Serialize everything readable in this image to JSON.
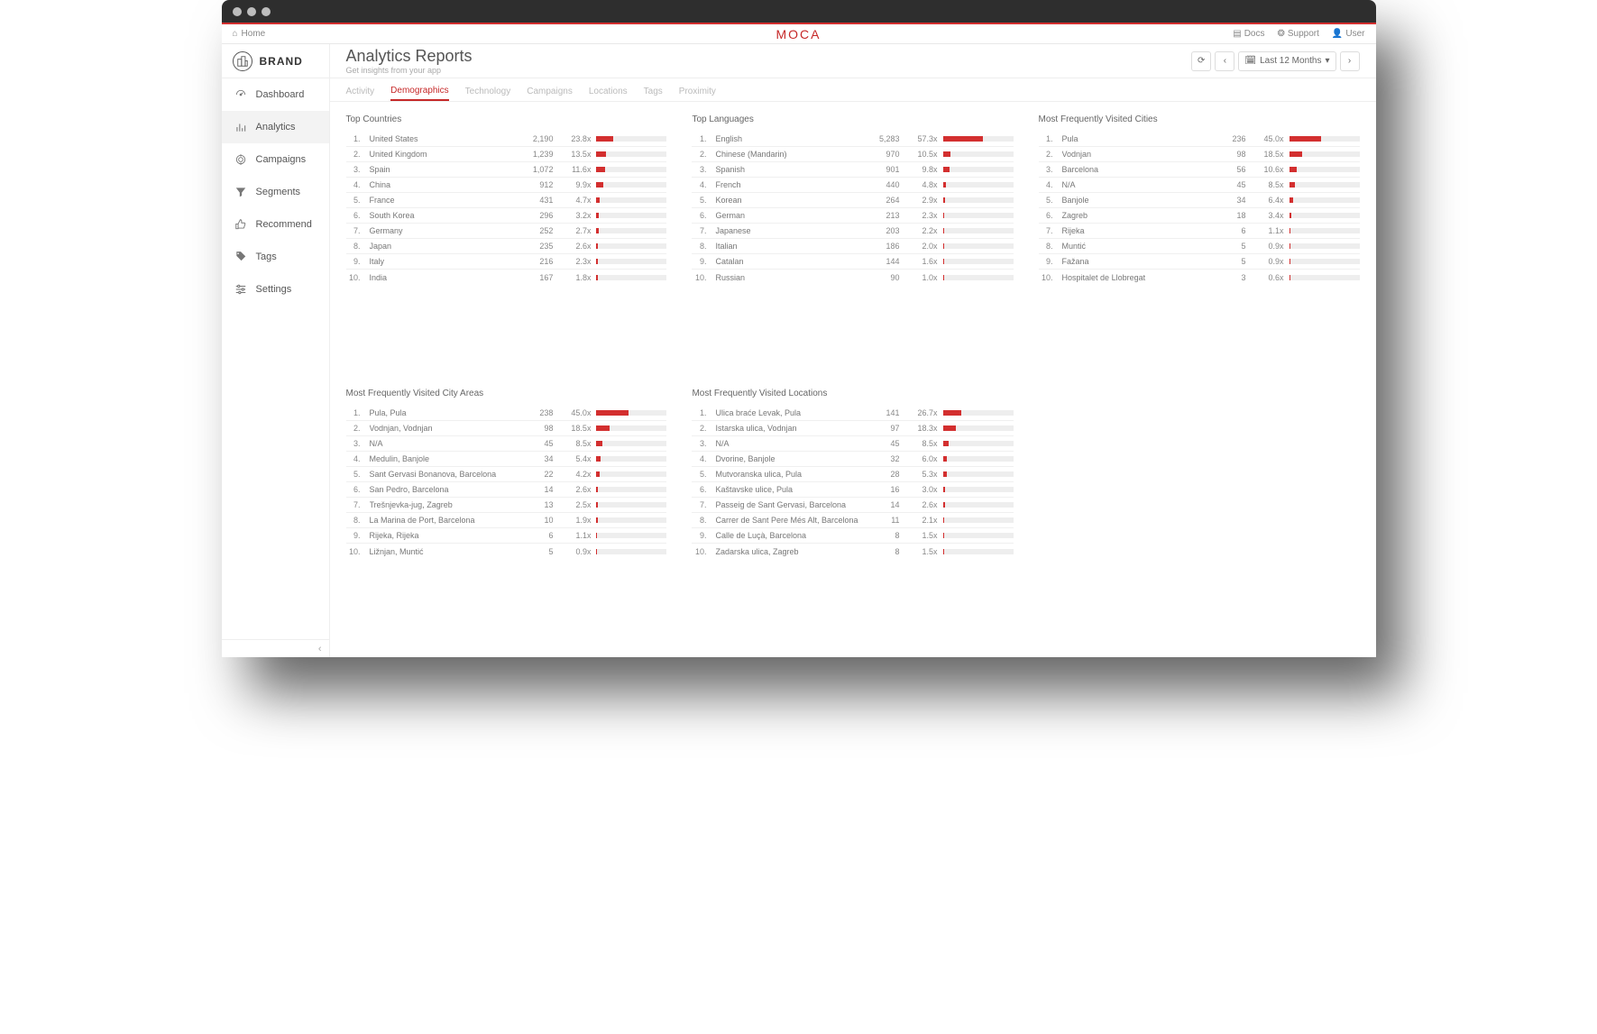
{
  "topbar": {
    "home": "Home",
    "logo": "MOCA",
    "docs": "Docs",
    "support": "Support",
    "user": "User"
  },
  "brand": {
    "name": "BRAND"
  },
  "sidebar": {
    "items": [
      {
        "id": "dashboard",
        "label": "Dashboard",
        "icon": "gauge"
      },
      {
        "id": "analytics",
        "label": "Analytics",
        "icon": "bars",
        "active": true
      },
      {
        "id": "campaigns",
        "label": "Campaigns",
        "icon": "target"
      },
      {
        "id": "segments",
        "label": "Segments",
        "icon": "filter"
      },
      {
        "id": "recommend",
        "label": "Recommend",
        "icon": "thumbs-up"
      },
      {
        "id": "tags",
        "label": "Tags",
        "icon": "tag"
      },
      {
        "id": "settings",
        "label": "Settings",
        "icon": "sliders"
      }
    ]
  },
  "header": {
    "title": "Analytics Reports",
    "subtitle": "Get insights from your app",
    "range_label": "Last 12 Months"
  },
  "tabs": [
    {
      "id": "activity",
      "label": "Activity"
    },
    {
      "id": "demographics",
      "label": "Demographics",
      "active": true
    },
    {
      "id": "technology",
      "label": "Technology"
    },
    {
      "id": "campaigns",
      "label": "Campaigns"
    },
    {
      "id": "locations",
      "label": "Locations"
    },
    {
      "id": "tags",
      "label": "Tags"
    },
    {
      "id": "proximity",
      "label": "Proximity"
    }
  ],
  "panels": [
    {
      "title": "Top Countries",
      "rows": [
        {
          "rank": "1.",
          "name": "United States",
          "count": "2,190",
          "pct": "23.8x",
          "bar": 23.8
        },
        {
          "rank": "2.",
          "name": "United Kingdom",
          "count": "1,239",
          "pct": "13.5x",
          "bar": 13.5
        },
        {
          "rank": "3.",
          "name": "Spain",
          "count": "1,072",
          "pct": "11.6x",
          "bar": 11.6
        },
        {
          "rank": "4.",
          "name": "China",
          "count": "912",
          "pct": "9.9x",
          "bar": 9.9
        },
        {
          "rank": "5.",
          "name": "France",
          "count": "431",
          "pct": "4.7x",
          "bar": 4.7
        },
        {
          "rank": "6.",
          "name": "South Korea",
          "count": "296",
          "pct": "3.2x",
          "bar": 3.2
        },
        {
          "rank": "7.",
          "name": "Germany",
          "count": "252",
          "pct": "2.7x",
          "bar": 2.7
        },
        {
          "rank": "8.",
          "name": "Japan",
          "count": "235",
          "pct": "2.6x",
          "bar": 2.6
        },
        {
          "rank": "9.",
          "name": "Italy",
          "count": "216",
          "pct": "2.3x",
          "bar": 2.3
        },
        {
          "rank": "10.",
          "name": "India",
          "count": "167",
          "pct": "1.8x",
          "bar": 1.8
        }
      ]
    },
    {
      "title": "Top Languages",
      "rows": [
        {
          "rank": "1.",
          "name": "English",
          "count": "5,283",
          "pct": "57.3x",
          "bar": 57.3
        },
        {
          "rank": "2.",
          "name": "Chinese (Mandarin)",
          "count": "970",
          "pct": "10.5x",
          "bar": 10.5
        },
        {
          "rank": "3.",
          "name": "Spanish",
          "count": "901",
          "pct": "9.8x",
          "bar": 9.8
        },
        {
          "rank": "4.",
          "name": "French",
          "count": "440",
          "pct": "4.8x",
          "bar": 4.8
        },
        {
          "rank": "5.",
          "name": "Korean",
          "count": "264",
          "pct": "2.9x",
          "bar": 2.9
        },
        {
          "rank": "6.",
          "name": "German",
          "count": "213",
          "pct": "2.3x",
          "bar": 2.3
        },
        {
          "rank": "7.",
          "name": "Japanese",
          "count": "203",
          "pct": "2.2x",
          "bar": 2.2
        },
        {
          "rank": "8.",
          "name": "Italian",
          "count": "186",
          "pct": "2.0x",
          "bar": 2.0
        },
        {
          "rank": "9.",
          "name": "Catalan",
          "count": "144",
          "pct": "1.6x",
          "bar": 1.6
        },
        {
          "rank": "10.",
          "name": "Russian",
          "count": "90",
          "pct": "1.0x",
          "bar": 1.0
        }
      ]
    },
    {
      "title": "Most Frequently Visited Cities",
      "rows": [
        {
          "rank": "1.",
          "name": "Pula",
          "count": "236",
          "pct": "45.0x",
          "bar": 45.0
        },
        {
          "rank": "2.",
          "name": "Vodnjan",
          "count": "98",
          "pct": "18.5x",
          "bar": 18.5
        },
        {
          "rank": "3.",
          "name": "Barcelona",
          "count": "56",
          "pct": "10.6x",
          "bar": 10.6
        },
        {
          "rank": "4.",
          "name": "N/A",
          "count": "45",
          "pct": "8.5x",
          "bar": 8.5
        },
        {
          "rank": "5.",
          "name": "Banjole",
          "count": "34",
          "pct": "6.4x",
          "bar": 6.4
        },
        {
          "rank": "6.",
          "name": "Zagreb",
          "count": "18",
          "pct": "3.4x",
          "bar": 3.4
        },
        {
          "rank": "7.",
          "name": "Rijeka",
          "count": "6",
          "pct": "1.1x",
          "bar": 1.1
        },
        {
          "rank": "8.",
          "name": "Muntić",
          "count": "5",
          "pct": "0.9x",
          "bar": 0.9
        },
        {
          "rank": "9.",
          "name": "Fažana",
          "count": "5",
          "pct": "0.9x",
          "bar": 0.9
        },
        {
          "rank": "10.",
          "name": "Hospitalet de Llobregat",
          "count": "3",
          "pct": "0.6x",
          "bar": 0.6
        }
      ]
    },
    {
      "title": "Most Frequently Visited City Areas",
      "rows": [
        {
          "rank": "1.",
          "name": "Pula, Pula",
          "count": "238",
          "pct": "45.0x",
          "bar": 45.0
        },
        {
          "rank": "2.",
          "name": "Vodnjan, Vodnjan",
          "count": "98",
          "pct": "18.5x",
          "bar": 18.5
        },
        {
          "rank": "3.",
          "name": "N/A",
          "count": "45",
          "pct": "8.5x",
          "bar": 8.5
        },
        {
          "rank": "4.",
          "name": "Medulin, Banjole",
          "count": "34",
          "pct": "5.4x",
          "bar": 5.4
        },
        {
          "rank": "5.",
          "name": "Sant Gervasi Bonanova, Barcelona",
          "count": "22",
          "pct": "4.2x",
          "bar": 4.2
        },
        {
          "rank": "6.",
          "name": "San Pedro, Barcelona",
          "count": "14",
          "pct": "2.6x",
          "bar": 2.6
        },
        {
          "rank": "7.",
          "name": "Trešnjevka-jug, Zagreb",
          "count": "13",
          "pct": "2.5x",
          "bar": 2.5
        },
        {
          "rank": "8.",
          "name": "La Marina de Port, Barcelona",
          "count": "10",
          "pct": "1.9x",
          "bar": 1.9
        },
        {
          "rank": "9.",
          "name": "Rijeka, Rijeka",
          "count": "6",
          "pct": "1.1x",
          "bar": 1.1
        },
        {
          "rank": "10.",
          "name": "Ližnjan, Muntić",
          "count": "5",
          "pct": "0.9x",
          "bar": 0.9
        }
      ]
    },
    {
      "title": "Most Frequently Visited Locations",
      "rows": [
        {
          "rank": "1.",
          "name": "Ulica braće Levak, Pula",
          "count": "141",
          "pct": "26.7x",
          "bar": 26.7
        },
        {
          "rank": "2.",
          "name": "Istarska ulica, Vodnjan",
          "count": "97",
          "pct": "18.3x",
          "bar": 18.3
        },
        {
          "rank": "3.",
          "name": "N/A",
          "count": "45",
          "pct": "8.5x",
          "bar": 8.5
        },
        {
          "rank": "4.",
          "name": "Dvorine, Banjole",
          "count": "32",
          "pct": "6.0x",
          "bar": 6.0
        },
        {
          "rank": "5.",
          "name": "Mutvoranska ulica, Pula",
          "count": "28",
          "pct": "5.3x",
          "bar": 5.3
        },
        {
          "rank": "6.",
          "name": "Kaštavske ulice, Pula",
          "count": "16",
          "pct": "3.0x",
          "bar": 3.0
        },
        {
          "rank": "7.",
          "name": "Passeig de Sant Gervasi, Barcelona",
          "count": "14",
          "pct": "2.6x",
          "bar": 2.6
        },
        {
          "rank": "8.",
          "name": "Carrer de Sant Pere Més Alt, Barcelona",
          "count": "11",
          "pct": "2.1x",
          "bar": 2.1
        },
        {
          "rank": "9.",
          "name": "Calle de Luçà, Barcelona",
          "count": "8",
          "pct": "1.5x",
          "bar": 1.5
        },
        {
          "rank": "10.",
          "name": "Zadarska ulica, Zagreb",
          "count": "8",
          "pct": "1.5x",
          "bar": 1.5
        }
      ]
    }
  ]
}
